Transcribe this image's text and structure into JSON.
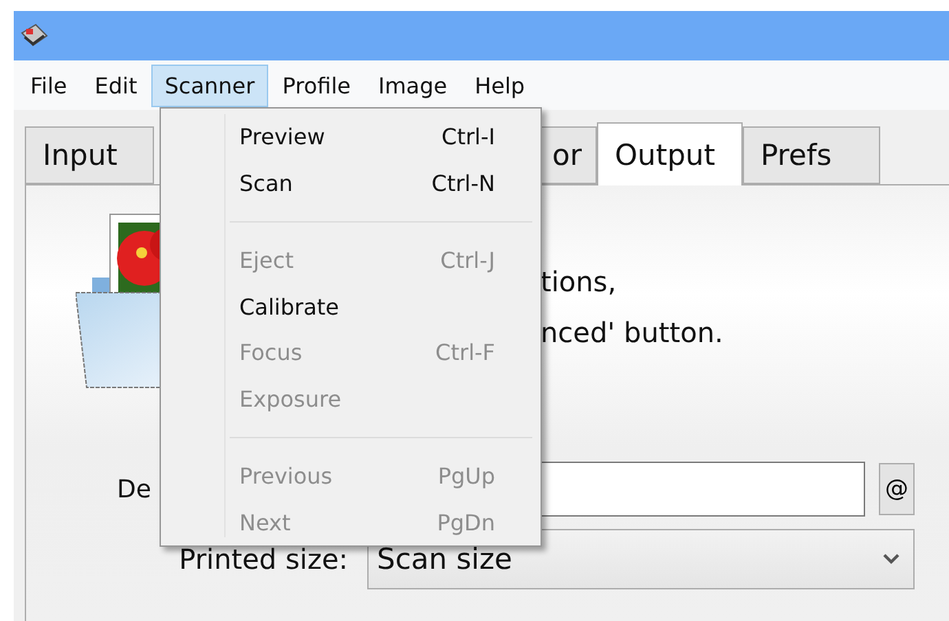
{
  "menubar": [
    {
      "label": "File",
      "selected": false
    },
    {
      "label": "Edit",
      "selected": false
    },
    {
      "label": "Scanner",
      "selected": true
    },
    {
      "label": "Profile",
      "selected": false
    },
    {
      "label": "Image",
      "selected": false
    },
    {
      "label": "Help",
      "selected": false
    }
  ],
  "tabs": [
    {
      "label": "Input",
      "selected": false
    },
    {
      "label": "or",
      "selected": false
    },
    {
      "label": "Output",
      "selected": true
    },
    {
      "label": "Prefs",
      "selected": false
    }
  ],
  "output_panel": {
    "info_lines": [
      "tions,",
      "nced' button."
    ],
    "field_label": "De",
    "field_button": "@",
    "size_label": "Printed size:",
    "size_value": "Scan size"
  },
  "scanner_menu": [
    {
      "kind": "item",
      "label": "Preview",
      "shortcut": "Ctrl-I",
      "disabled": false
    },
    {
      "kind": "item",
      "label": "Scan",
      "shortcut": "Ctrl-N",
      "disabled": false
    },
    {
      "kind": "separator"
    },
    {
      "kind": "item",
      "label": "Eject",
      "shortcut": "Ctrl-J",
      "disabled": true
    },
    {
      "kind": "item",
      "label": "Calibrate",
      "disabled": false
    },
    {
      "kind": "item",
      "label": "Focus",
      "shortcut": "Ctrl-F",
      "disabled": true
    },
    {
      "kind": "item",
      "label": "Exposure",
      "disabled": true
    },
    {
      "kind": "separator"
    },
    {
      "kind": "item",
      "label": "Previous",
      "shortcut": "PgUp",
      "disabled": true
    },
    {
      "kind": "item",
      "label": "Next",
      "shortcut": "PgDn",
      "disabled": true
    }
  ]
}
